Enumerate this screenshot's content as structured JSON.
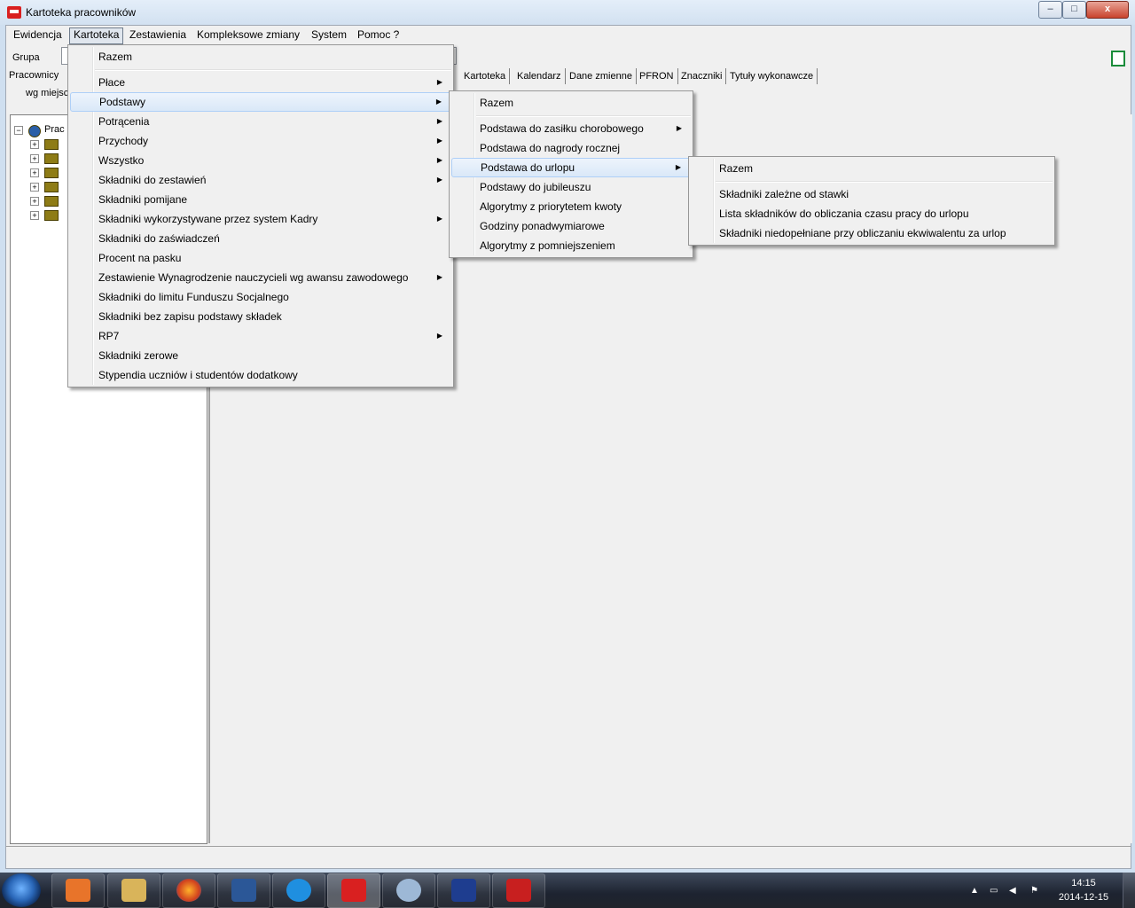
{
  "window": {
    "title": "Kartoteka pracowników",
    "min_label": "–",
    "max_label": "□",
    "close_label": "x"
  },
  "menubar": [
    "Ewidencja",
    "Kartoteka",
    "Zestawienia",
    "Kompleksowe zmiany",
    "System",
    "Pomoc ?"
  ],
  "left_panel": {
    "group_label": "Grupa",
    "tab_label": "Pracownicy",
    "sub_label": "wg miejsc",
    "tree_root_label": "Prac"
  },
  "tabs": [
    "Kartoteka",
    "Kalendarz",
    "Dane zmienne",
    "PFRON",
    "Znaczniki",
    "Tytuły wykonawcze"
  ],
  "menu_kartoteka": [
    {
      "label": "Razem",
      "arrow": false
    },
    {
      "label": "Płace",
      "arrow": true
    },
    {
      "label": "Podstawy",
      "arrow": true,
      "highlighted": true
    },
    {
      "label": "Potrącenia",
      "arrow": true
    },
    {
      "label": "Przychody",
      "arrow": true
    },
    {
      "label": "Wszystko",
      "arrow": true
    },
    {
      "label": "Składniki do zestawień",
      "arrow": true
    },
    {
      "label": "Składniki pomijane",
      "arrow": false
    },
    {
      "label": "Składniki wykorzystywane przez system Kadry",
      "arrow": true
    },
    {
      "label": "Składniki do zaświadczeń",
      "arrow": false
    },
    {
      "label": "Procent na pasku",
      "arrow": false
    },
    {
      "label": "Zestawienie Wynagrodzenie nauczycieli wg awansu zawodowego",
      "arrow": true
    },
    {
      "label": "Składniki do limitu Funduszu Socjalnego",
      "arrow": false
    },
    {
      "label": "Składniki bez zapisu podstawy składek",
      "arrow": false
    },
    {
      "label": "RP7",
      "arrow": true
    },
    {
      "label": "Składniki zerowe",
      "arrow": false
    },
    {
      "label": "Stypendia uczniów i studentów dodatkowy",
      "arrow": false
    }
  ],
  "menu_podstawy": [
    {
      "label": "Razem",
      "arrow": false
    },
    {
      "label": "Podstawa do zasiłku chorobowego",
      "arrow": true
    },
    {
      "label": "Podstawa do nagrody rocznej",
      "arrow": false
    },
    {
      "label": "Podstawa do urlopu",
      "arrow": true,
      "highlighted": true
    },
    {
      "label": "Podstawy do jubileuszu",
      "arrow": false
    },
    {
      "label": "Algorytmy z priorytetem kwoty",
      "arrow": false
    },
    {
      "label": "Godziny ponadwymiarowe",
      "arrow": false
    },
    {
      "label": "Algorytmy z pomniejszeniem",
      "arrow": false
    }
  ],
  "menu_urlop": [
    {
      "label": "Razem"
    },
    {
      "label": "Składniki zależne od stawki"
    },
    {
      "label": "Lista składników do obliczania czasu pracy do urlopu"
    },
    {
      "label": "Składniki niedopełniane przy obliczaniu ekwiwalentu za urlop"
    }
  ],
  "arrow_glyph": "▶",
  "taskbar": {
    "apps": [
      "media-player-icon",
      "explorer-icon",
      "firefox-icon",
      "word-icon",
      "ie-icon",
      "app-icon",
      "paint-icon",
      "p-app-icon",
      "pdf-reader-icon"
    ],
    "time": "14:15",
    "date": "2014-12-15"
  }
}
